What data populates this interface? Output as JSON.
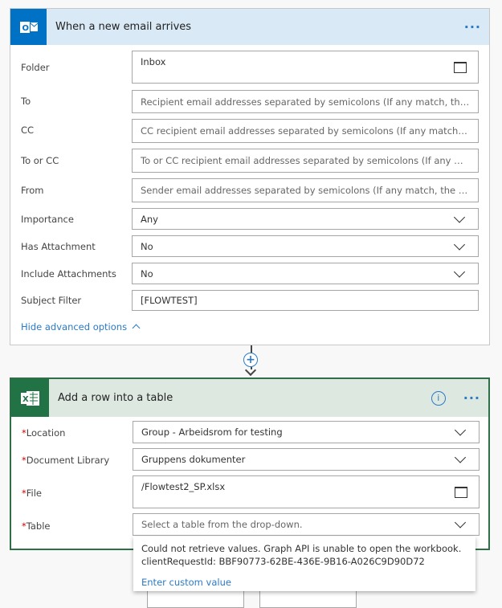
{
  "trigger": {
    "title": "When a new email arrives",
    "icon": "outlook-icon",
    "more": "···",
    "accent": "#0072c6",
    "fields": [
      {
        "label": "Folder",
        "value": "Inbox",
        "placeholder": ""
      },
      {
        "label": "To",
        "value": "",
        "placeholder": "Recipient email addresses separated by semicolons (If any match, the trigger..."
      },
      {
        "label": "CC",
        "value": "",
        "placeholder": "CC recipient email addresses separated by semicolons (If any match, the trigg..."
      },
      {
        "label": "To or CC",
        "value": "",
        "placeholder": "To or CC recipient email addresses separated by semicolons (If any match, th..."
      },
      {
        "label": "From",
        "value": "",
        "placeholder": "Sender email addresses separated by semicolons (If any match, the trigger wi..."
      },
      {
        "label": "Importance",
        "value": "Any"
      },
      {
        "label": "Has Attachment",
        "value": "No"
      },
      {
        "label": "Include Attachments",
        "value": "No"
      },
      {
        "label": "Subject Filter",
        "value": "[FLOWTEST]"
      }
    ],
    "hide_advanced": "Hide advanced options"
  },
  "connector": {
    "plus": "+"
  },
  "action": {
    "title": "Add a row into a table",
    "icon": "excel-icon",
    "more": "···",
    "info": "i",
    "accent": "#217346",
    "required_mark": "*",
    "fields": [
      {
        "label": "Location",
        "value": "Group - Arbeidsrom for testing"
      },
      {
        "label": "Document Library",
        "value": "Gruppens dokumenter"
      },
      {
        "label": "File",
        "value": "/Flowtest2_SP.xlsx"
      },
      {
        "label": "Table",
        "placeholder": "Select a table from the drop-down."
      }
    ]
  },
  "dropdown": {
    "error_line1": "Could not retrieve values. Graph API is unable to open the workbook.",
    "error_line2": "clientRequestId: BBF90773-62BE-436E-9B16-A026C9D90D72",
    "custom": "Enter custom value"
  }
}
